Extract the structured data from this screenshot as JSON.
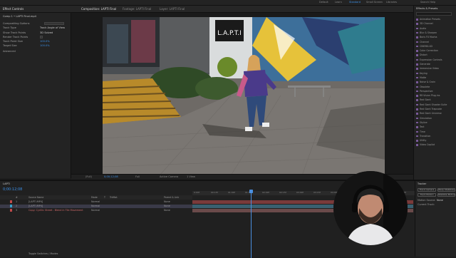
{
  "workspaces": [
    "Default",
    "Learn",
    "Standard",
    "Small Screen",
    "Libraries"
  ],
  "active_workspace": "Standard",
  "search_placeholder": "Search Help",
  "left_panel": {
    "tab": "Effect Controls",
    "layer": "Comp 1 • LAPTI Final.mp4",
    "rows": [
      {
        "label": "Compositing Options",
        "value": ""
      },
      {
        "label": "Track Type",
        "value": "Track Angle of View"
      },
      {
        "label": "Show Track Points",
        "value": "3D Solved"
      },
      {
        "label": "Render Track Points",
        "value": ""
      },
      {
        "label": "Track Point Size",
        "value": "100.0%"
      },
      {
        "label": "Target Size",
        "value": "100.0%"
      },
      {
        "label": "Advanced",
        "value": ""
      }
    ]
  },
  "viewer": {
    "tabs": [
      "Composition: LAPTI Final",
      "Footage: LAPTI Final",
      "Layer: LAPTI Final"
    ],
    "sign_text": "L.A.P.T.I",
    "zoom": "(Full)",
    "timecode": "0;00;12;08",
    "camera": "Active Camera",
    "views": "1 View",
    "quality": "Full"
  },
  "effects_panel": {
    "title": "Effects & Presets",
    "items": [
      "Animation Presets",
      "3D Channel",
      "Audio",
      "Blur & Sharpen",
      "Boris FX Mocha",
      "Channel",
      "CINEMA 4D",
      "Color Correction",
      "Distort",
      "Expression Controls",
      "Generate",
      "Immersive Video",
      "Keying",
      "Matte",
      "Noise & Grain",
      "Obsolete",
      "Perspective",
      "RE:Vision Plug-ins",
      "Red Giant",
      "Red Giant Shooter Suite",
      "Red Giant Trapcode",
      "Red Giant Universe",
      "Simulation",
      "Stylize",
      "Text",
      "Time",
      "Transition",
      "Utility",
      "Video Copilot"
    ]
  },
  "timeline": {
    "comp_name": "LAPTI",
    "timecode": "0;00:12;08",
    "header": [
      "#",
      "Source Name",
      "Mode",
      "T",
      "TrkMat",
      "Parent & Link"
    ],
    "layers": [
      {
        "num": "1",
        "name": "[LAPTI.MP4]",
        "mode": "Normal",
        "parent": "None",
        "color": "#c04a4a"
      },
      {
        "num": "2",
        "name": "[LAPTI.MP4]",
        "mode": "Normal",
        "parent": "None",
        "color": "#3aa0c8"
      },
      {
        "num": "3",
        "name": "Copy: Cyrillic Street - Blend in Tile Movement",
        "mode": "Normal",
        "parent": "None",
        "color": "#c04a4a"
      }
    ],
    "ruler": [
      "0:00f",
      "00:15f",
      "01:00f",
      "01:15f",
      "02:00f",
      "02:15f",
      "03:00f",
      "03:15f",
      "04:00f",
      "04:15f",
      "05:00f",
      "05:15f",
      "06:00f"
    ],
    "footer": "Toggle Switches / Modes"
  },
  "right_bottom": {
    "title": "Tracker",
    "buttons": [
      "Track Camera",
      "Warp Stabilizer",
      "Track Motion",
      "Stabilize Motion"
    ],
    "motion_source": "Motion Source:",
    "source_value": "None",
    "current_track": "Current Track:"
  },
  "colors": {
    "accent": "#3b8fe6",
    "playhead": "#4a8fe0",
    "label_purple": "#7a5a9a"
  }
}
